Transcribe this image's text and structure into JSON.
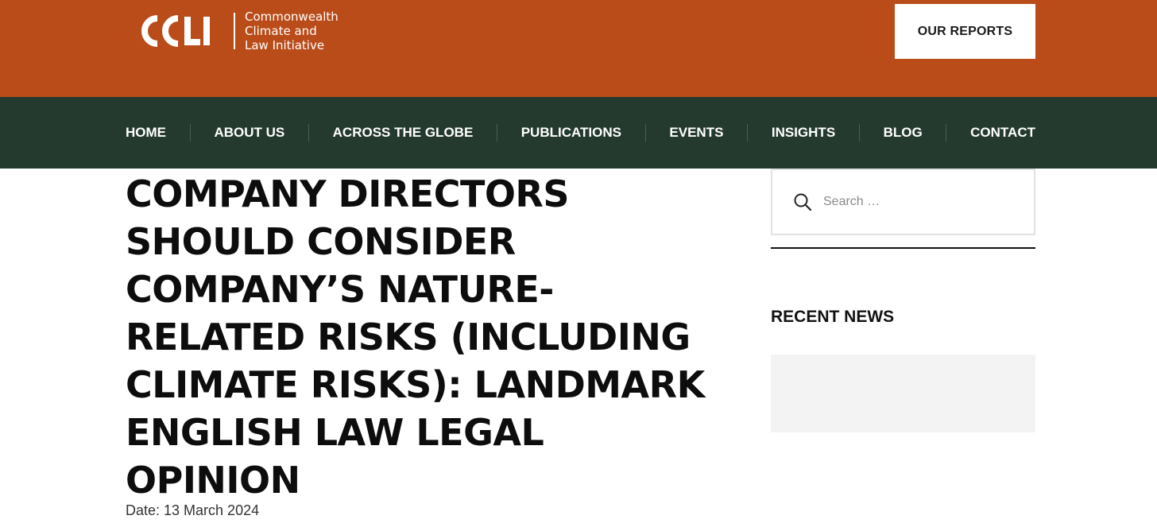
{
  "header": {
    "logo": {
      "mark_text": "CCLI",
      "lines": [
        "Commonwealth",
        "Climate and",
        "Law Initiative"
      ]
    },
    "reports_button_label": "OUR REPORTS",
    "brand_color": "#b94c19"
  },
  "nav": {
    "background": "#253a2e",
    "items": [
      {
        "label": "HOME"
      },
      {
        "label": "ABOUT US"
      },
      {
        "label": "ACROSS THE GLOBE"
      },
      {
        "label": "PUBLICATIONS"
      },
      {
        "label": "EVENTS"
      },
      {
        "label": "INSIGHTS"
      },
      {
        "label": "BLOG"
      },
      {
        "label": "CONTACT"
      }
    ]
  },
  "article": {
    "title": "COMPANY DIRECTORS SHOULD CONSIDER COMPANY’S NATURE-RELATED RISKS (INCLUDING CLIMATE RISKS): LANDMARK ENGLISH LAW LEGAL OPINION",
    "date": "Date: 13 March 2024"
  },
  "sidebar": {
    "search": {
      "placeholder": "Search …",
      "icon": "search-icon"
    },
    "recent_news_title": "RECENT NEWS"
  }
}
